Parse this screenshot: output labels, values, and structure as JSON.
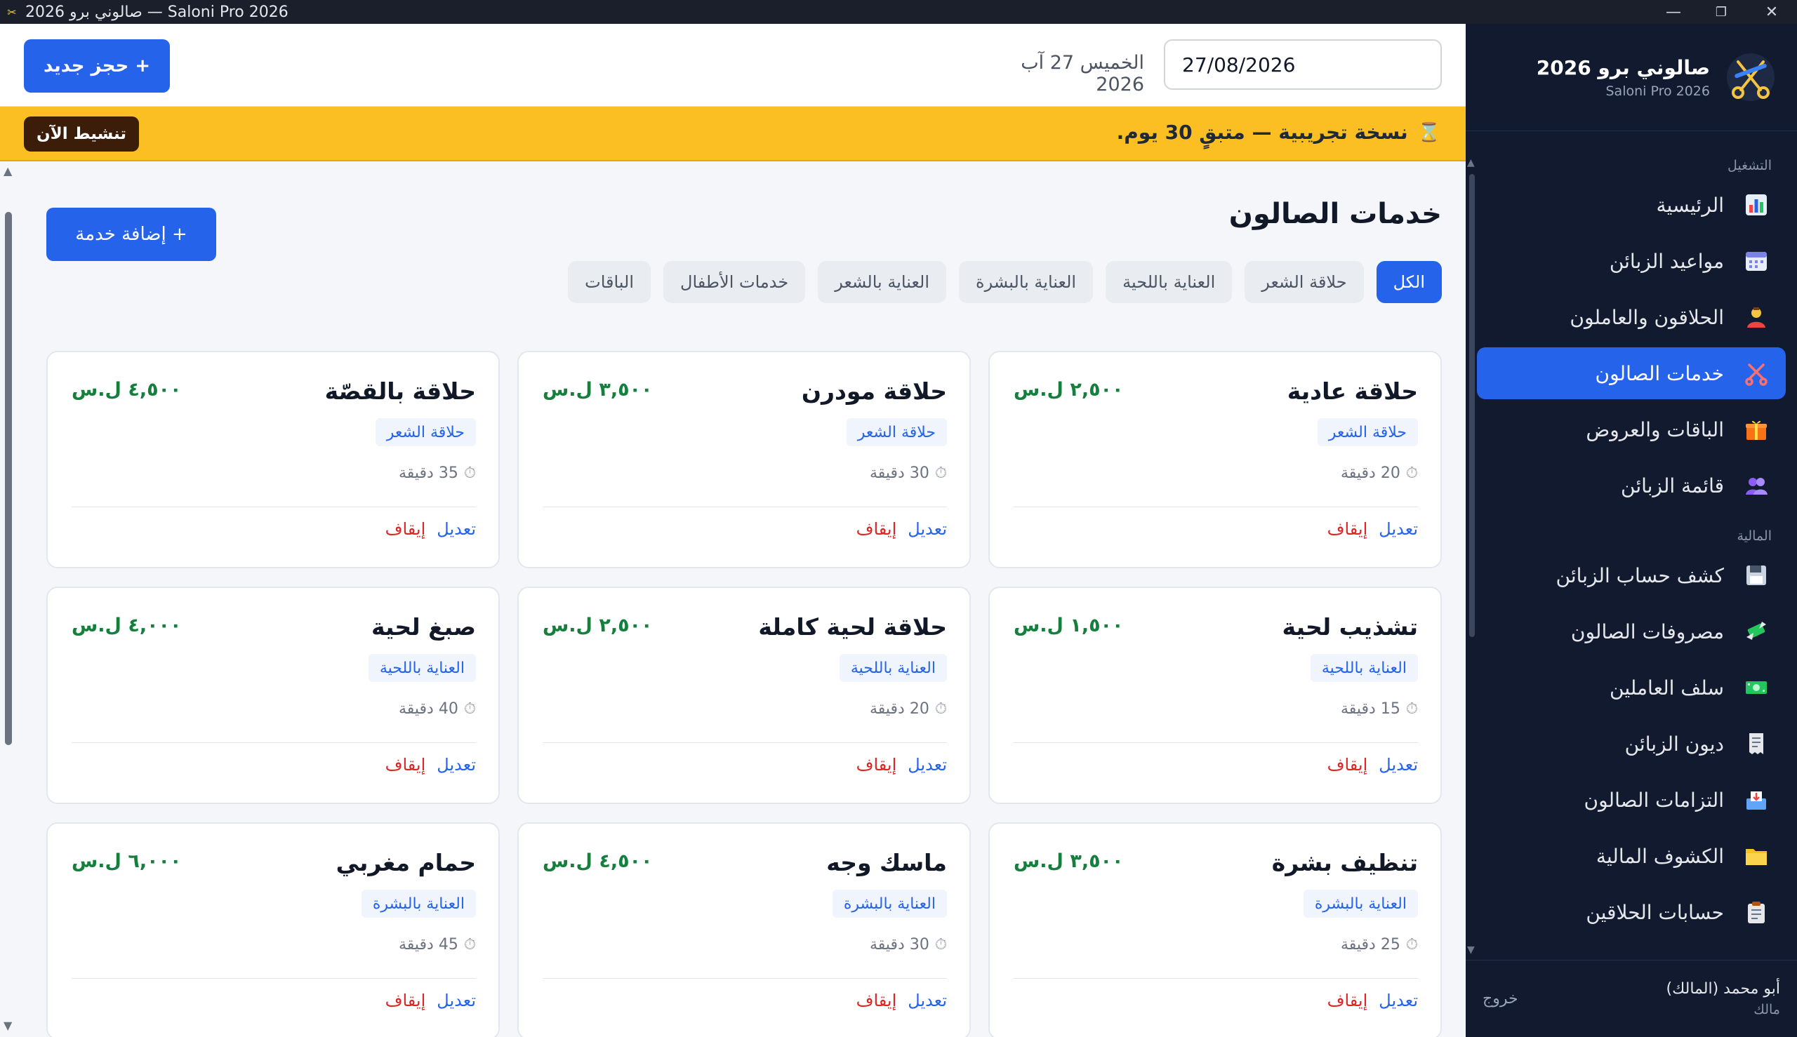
{
  "window": {
    "title": "صالوني برو 2026 — Saloni Pro 2026",
    "minimize": "—",
    "maximize": "❐",
    "close": "✕"
  },
  "brand": {
    "title": "صالوني برو 2026",
    "subtitle": "Saloni Pro 2026"
  },
  "sidebar": {
    "sections": [
      {
        "label": "التشغيل",
        "items": [
          {
            "label": "الرئيسية",
            "icon": "bar-chart-icon",
            "active": false
          },
          {
            "label": "مواعيد الزبائن",
            "icon": "calendar-icon",
            "active": false
          },
          {
            "label": "الحلاقون والعاملون",
            "icon": "barber-icon",
            "active": false
          },
          {
            "label": "خدمات الصالون",
            "icon": "scissors-icon",
            "active": true
          },
          {
            "label": "الباقات والعروض",
            "icon": "gift-icon",
            "active": false
          },
          {
            "label": "قائمة الزبائن",
            "icon": "users-icon",
            "active": false
          }
        ]
      },
      {
        "label": "المالية",
        "items": [
          {
            "label": "كشف حساب الزبائن",
            "icon": "floppy-icon",
            "active": false
          },
          {
            "label": "مصروفات الصالون",
            "icon": "money-wings-icon",
            "active": false
          },
          {
            "label": "سلف العاملين",
            "icon": "cash-icon",
            "active": false
          },
          {
            "label": "ديون الزبائن",
            "icon": "receipt-icon",
            "active": false
          },
          {
            "label": "التزامات الصالون",
            "icon": "inbox-icon",
            "active": false
          },
          {
            "label": "الكشوف المالية",
            "icon": "folder-icon",
            "active": false
          },
          {
            "label": "حسابات الحلاقين",
            "icon": "clipboard-icon",
            "active": false
          }
        ]
      }
    ],
    "user": {
      "name": "أبو محمد (المالك)",
      "role": "مالك"
    },
    "logout": "خروج"
  },
  "topbar": {
    "new_booking": "+ حجز جديد",
    "date_value": "27/08/2026",
    "date_label": "الخميس 27 آب 2026"
  },
  "trial": {
    "icon": "hourglass-icon",
    "message": "نسخة تجريبية — متبقٍ 30 يوم.",
    "activate": "تنشيط الآن"
  },
  "page": {
    "title": "خدمات الصالون",
    "add_service": "+ إضافة خدمة",
    "filters": [
      {
        "label": "الكل",
        "active": true
      },
      {
        "label": "حلاقة الشعر",
        "active": false
      },
      {
        "label": "العناية باللحية",
        "active": false
      },
      {
        "label": "العناية بالبشرة",
        "active": false
      },
      {
        "label": "العناية بالشعر",
        "active": false
      },
      {
        "label": "خدمات الأطفال",
        "active": false
      },
      {
        "label": "الباقات",
        "active": false
      }
    ],
    "edit_label": "تعديل",
    "stop_label": "إيقاف",
    "services": [
      {
        "name": "حلاقة عادية",
        "category": "حلاقة الشعر",
        "duration": "20 دقيقة",
        "price": "٢,٥٠٠ ل.س"
      },
      {
        "name": "حلاقة مودرن",
        "category": "حلاقة الشعر",
        "duration": "30 دقيقة",
        "price": "٣,٥٠٠ ل.س"
      },
      {
        "name": "حلاقة بالقصّة",
        "category": "حلاقة الشعر",
        "duration": "35 دقيقة",
        "price": "٤,٥٠٠ ل.س"
      },
      {
        "name": "تشذيب لحية",
        "category": "العناية باللحية",
        "duration": "15 دقيقة",
        "price": "١,٥٠٠ ل.س"
      },
      {
        "name": "حلاقة لحية كاملة",
        "category": "العناية باللحية",
        "duration": "20 دقيقة",
        "price": "٢,٥٠٠ ل.س"
      },
      {
        "name": "صبغ لحية",
        "category": "العناية باللحية",
        "duration": "40 دقيقة",
        "price": "٤,٠٠٠ ل.س"
      },
      {
        "name": "تنظيف بشرة",
        "category": "العناية بالبشرة",
        "duration": "25 دقيقة",
        "price": "٣,٥٠٠ ل.س"
      },
      {
        "name": "ماسك وجه",
        "category": "العناية بالبشرة",
        "duration": "30 دقيقة",
        "price": "٤,٥٠٠ ل.س"
      },
      {
        "name": "حمام مغربي",
        "category": "العناية بالبشرة",
        "duration": "45 دقيقة",
        "price": "٦,٠٠٠ ل.س"
      }
    ]
  },
  "colors": {
    "accent": "#2563eb",
    "sidebar_bg": "#111a2e",
    "trial_bg": "#fbbf24",
    "price": "#15803d",
    "stop": "#dc2626"
  }
}
